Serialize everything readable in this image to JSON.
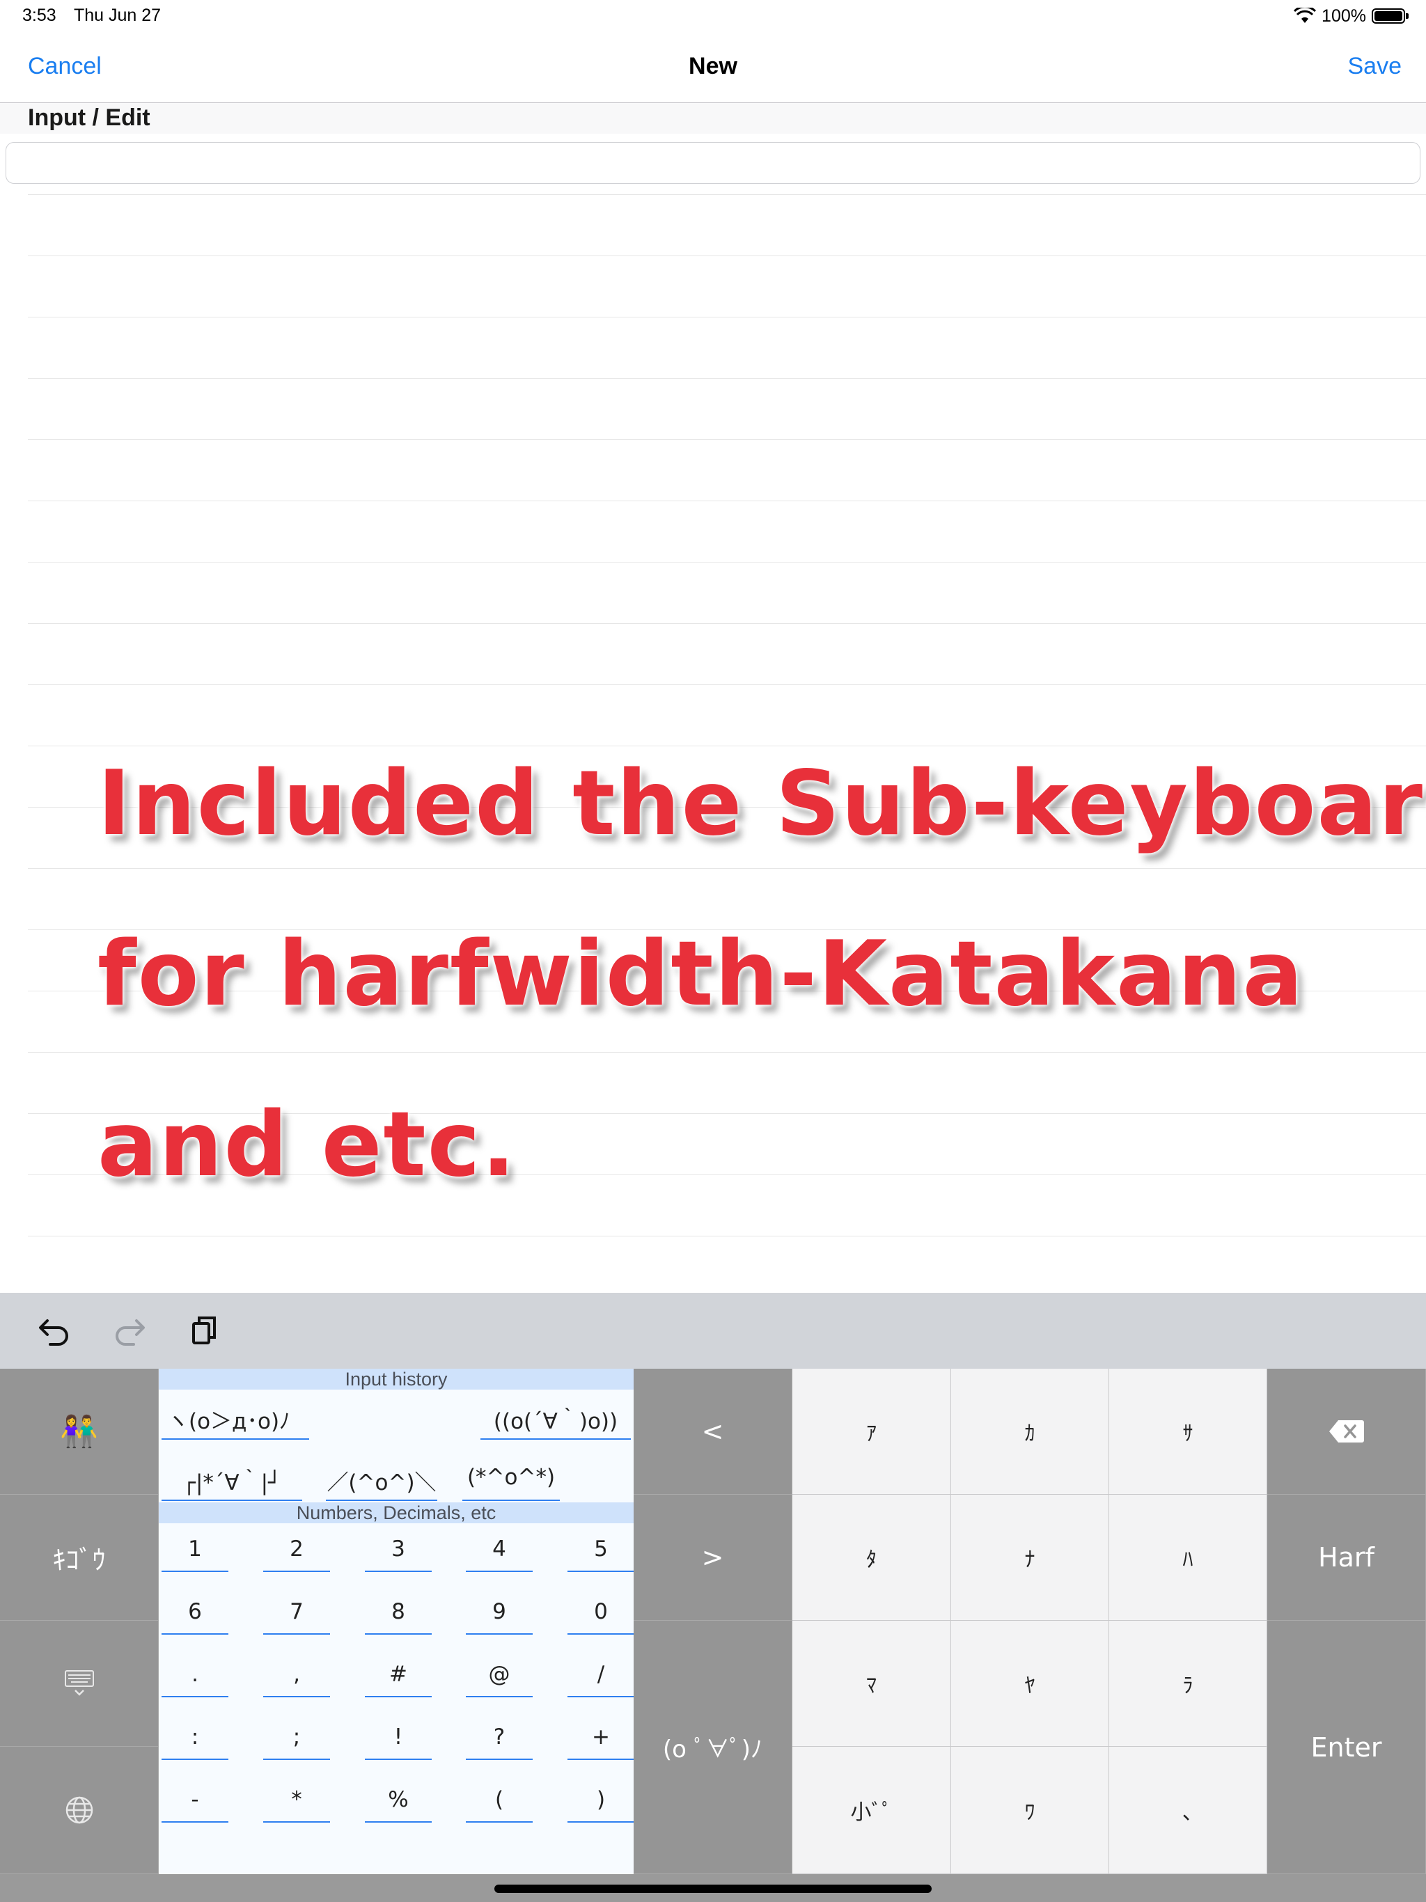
{
  "status_bar": {
    "time": "3:53",
    "date": "Thu Jun 27",
    "battery": "100%"
  },
  "nav": {
    "cancel": "Cancel",
    "title": "New",
    "save": "Save"
  },
  "section": {
    "header": "Input / Edit"
  },
  "input": {
    "value": "",
    "placeholder": ""
  },
  "promo": {
    "line1": "Included the Sub-keyboard",
    "line2": "for harfwidth-Katakana",
    "line3": "and etc."
  },
  "toolbar": {
    "icons": [
      "undo-icon",
      "redo-icon",
      "copy-icon"
    ]
  },
  "keyboard": {
    "left_column": {
      "emoji": "👫",
      "kigou": "ｷｺﾞｳ",
      "hide_icon": "keyboard-hide-icon",
      "globe_icon": "globe-icon"
    },
    "input_history": {
      "title": "Input history",
      "items": [
        "ヽ(o＞д･o)ﾉ",
        "((o(´∀｀)o))",
        "┌|*´∀｀|┘",
        "／(^o^)＼",
        "(*^o^*)"
      ]
    },
    "numbers": {
      "title": "Numbers, Decimals, etc",
      "rows": [
        [
          "1",
          "2",
          "3",
          "4",
          "5"
        ],
        [
          "6",
          "7",
          "8",
          "9",
          "0"
        ],
        [
          ".",
          ",",
          "#",
          "@",
          "/"
        ],
        [
          ":",
          ";",
          "!",
          "?",
          "+"
        ],
        [
          "-",
          "*",
          "%",
          "(",
          ")"
        ]
      ]
    },
    "arrows": {
      "left": "<",
      "right": ">"
    },
    "kaomoji_key": "(o ﾟ∀ﾟ)ﾉ",
    "kana": {
      "row1": [
        "ｱ",
        "ｶ",
        "ｻ"
      ],
      "row2": [
        "ﾀ",
        "ﾅ",
        "ﾊ"
      ],
      "row3": [
        "ﾏ",
        "ﾔ",
        "ﾗ"
      ],
      "row4": [
        "小ﾞﾟ",
        "ﾜ",
        "､"
      ]
    },
    "right_column": {
      "delete_icon": "delete-icon",
      "harf": "Harf",
      "enter": "Enter"
    }
  },
  "colors": {
    "accent": "#1a7ef0",
    "promo": "#e8303a",
    "key_dark": "#959595",
    "key_light": "#f3f3f4",
    "band": "#cfe2fb"
  }
}
